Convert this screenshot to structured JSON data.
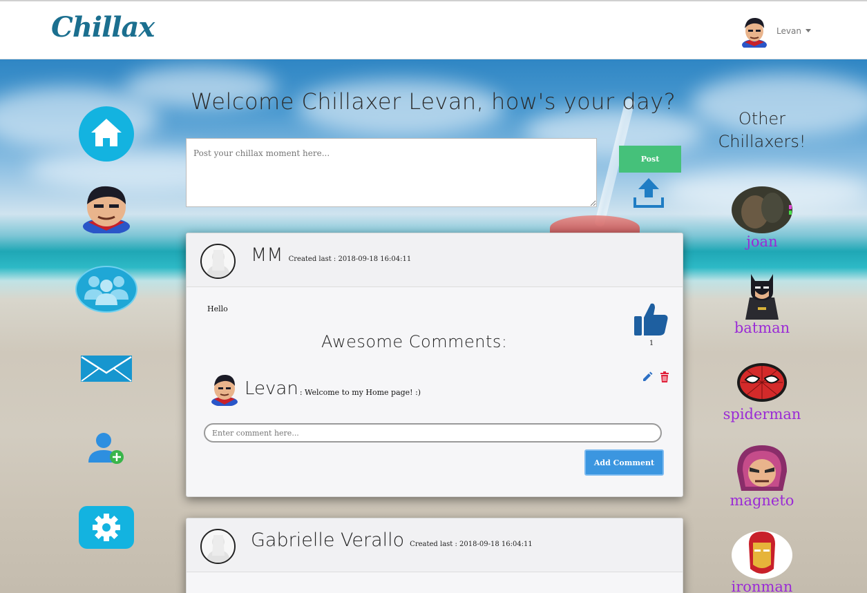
{
  "navbar": {
    "brand": "Chillax",
    "user_name": "Levan"
  },
  "sidebar": {
    "items": [
      {
        "icon": "home-icon"
      },
      {
        "icon": "profile-avatar-icon"
      },
      {
        "icon": "groups-icon"
      },
      {
        "icon": "mail-icon"
      },
      {
        "icon": "add-user-icon"
      },
      {
        "icon": "settings-icon"
      }
    ]
  },
  "main": {
    "welcome": "Welcome Chillaxer Levan, how's your day?",
    "post_placeholder": "Post your chillax moment here...",
    "post_button": "Post",
    "posts": [
      {
        "author": "MM",
        "created": "Created last : 2018-09-18 16:04:11",
        "text": "Hello",
        "likes": "1",
        "comments_title": "Awesome Comments:",
        "comments": [
          {
            "author": "Levan",
            "text": ": Welcome to my Home page! :)"
          }
        ],
        "comment_placeholder": "Enter comment here...",
        "add_comment": "Add Comment"
      },
      {
        "author": "Gabrielle Verallo",
        "created": "Created last : 2018-09-18 16:04:11"
      }
    ]
  },
  "right": {
    "title_line1": "Other",
    "title_line2": "Chillaxers!",
    "friends": [
      {
        "name": "joan"
      },
      {
        "name": "batman"
      },
      {
        "name": "spiderman"
      },
      {
        "name": "magneto"
      },
      {
        "name": "ironman"
      }
    ]
  },
  "colors": {
    "brand": "#1b6f8f",
    "accent_blue": "#3b96e0",
    "post_green": "#45c17a",
    "friend_name": "#9a2ad6",
    "delete_red": "#e0203a"
  }
}
